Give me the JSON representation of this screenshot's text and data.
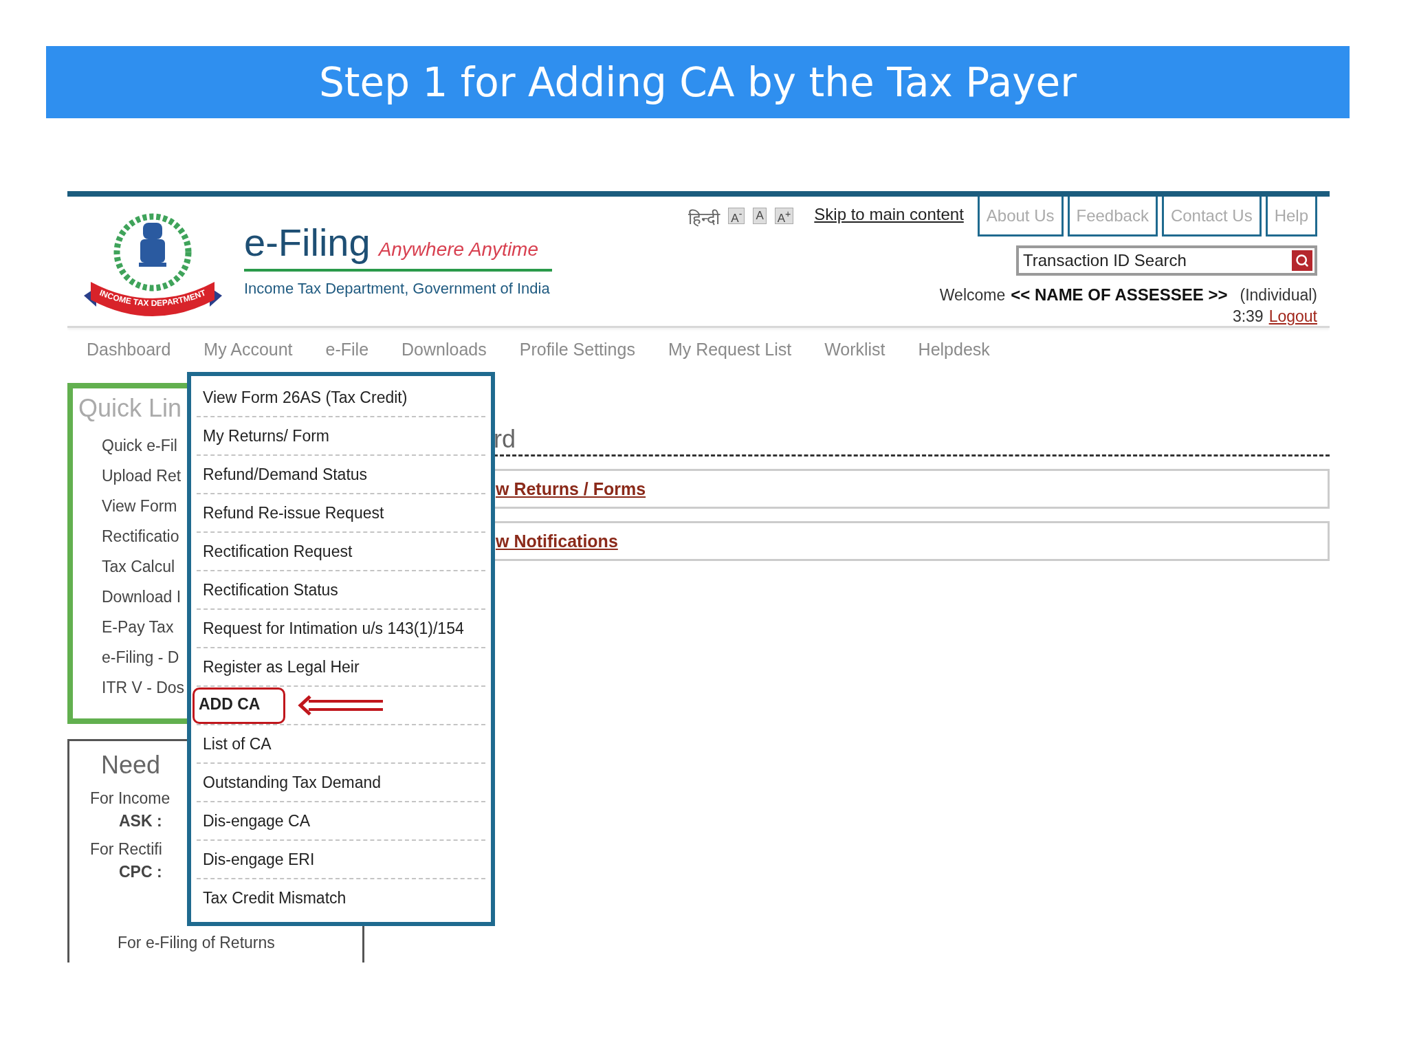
{
  "slide_title": "Step 1 for Adding CA by the Tax Payer",
  "header": {
    "logo_text": "INCOME TAX DEPARTMENT",
    "brand": "e-Filing",
    "tagline": "Anywhere Anytime",
    "subtitle": "Income Tax Department, Government of India",
    "language_link": "हिन्दी",
    "font_size_buttons": [
      "A$^{-}$",
      "A",
      "A$^{+}$"
    ],
    "skip_link": "Skip to main content",
    "top_tabs": [
      "About Us",
      "Feedback",
      "Contact Us",
      "Help"
    ],
    "search": {
      "placeholder": "Transaction ID Search"
    },
    "welcome": {
      "label": "Welcome",
      "name": "<< NAME OF ASSESSEE >>",
      "role": "(Individual)",
      "time": "3:39",
      "logout": "Logout"
    }
  },
  "nav": [
    "Dashboard",
    "My Account",
    "e-File",
    "Downloads",
    "Profile Settings",
    "My Request List",
    "Worklist",
    "Helpdesk"
  ],
  "quick_links": {
    "title": "Quick Lin",
    "items": [
      "Quick e-Fil",
      "Upload Ret",
      "View Form",
      "Rectificatio",
      "Tax Calcul",
      "Download I",
      "E-Pay Tax",
      "e-Filing - D",
      "ITR V - Dos"
    ]
  },
  "help_box": {
    "title": "Need",
    "lines": [
      {
        "text": "For Income",
        "bold": false
      },
      {
        "text": "ASK :",
        "bold": true
      },
      {
        "text": "For Rectifi",
        "bold": false
      },
      {
        "text": "CPC :",
        "bold": true
      },
      {
        "text": "For e-Filing of Returns",
        "bold": false
      }
    ]
  },
  "dashboard": {
    "heading": "rd",
    "links": [
      "w Returns / Forms",
      "w Notifications"
    ]
  },
  "menu": [
    {
      "label": "View Form 26AS (Tax Credit)",
      "highlighted": false
    },
    {
      "label": "My Returns/ Form",
      "highlighted": false
    },
    {
      "label": "Refund/Demand Status",
      "highlighted": false
    },
    {
      "label": "Refund Re-issue Request",
      "highlighted": false
    },
    {
      "label": "Rectification Request",
      "highlighted": false
    },
    {
      "label": "Rectification Status",
      "highlighted": false
    },
    {
      "label": "Request for Intimation u/s 143(1)/154",
      "highlighted": false
    },
    {
      "label": "Register as Legal Heir",
      "highlighted": false
    },
    {
      "label": "ADD CA",
      "highlighted": true
    },
    {
      "label": "List of CA",
      "highlighted": false
    },
    {
      "label": "Outstanding Tax Demand",
      "highlighted": false
    },
    {
      "label": "Dis-engage CA",
      "highlighted": false
    },
    {
      "label": "Dis-engage ERI",
      "highlighted": false
    },
    {
      "label": "Tax Credit Mismatch",
      "highlighted": false
    }
  ]
}
